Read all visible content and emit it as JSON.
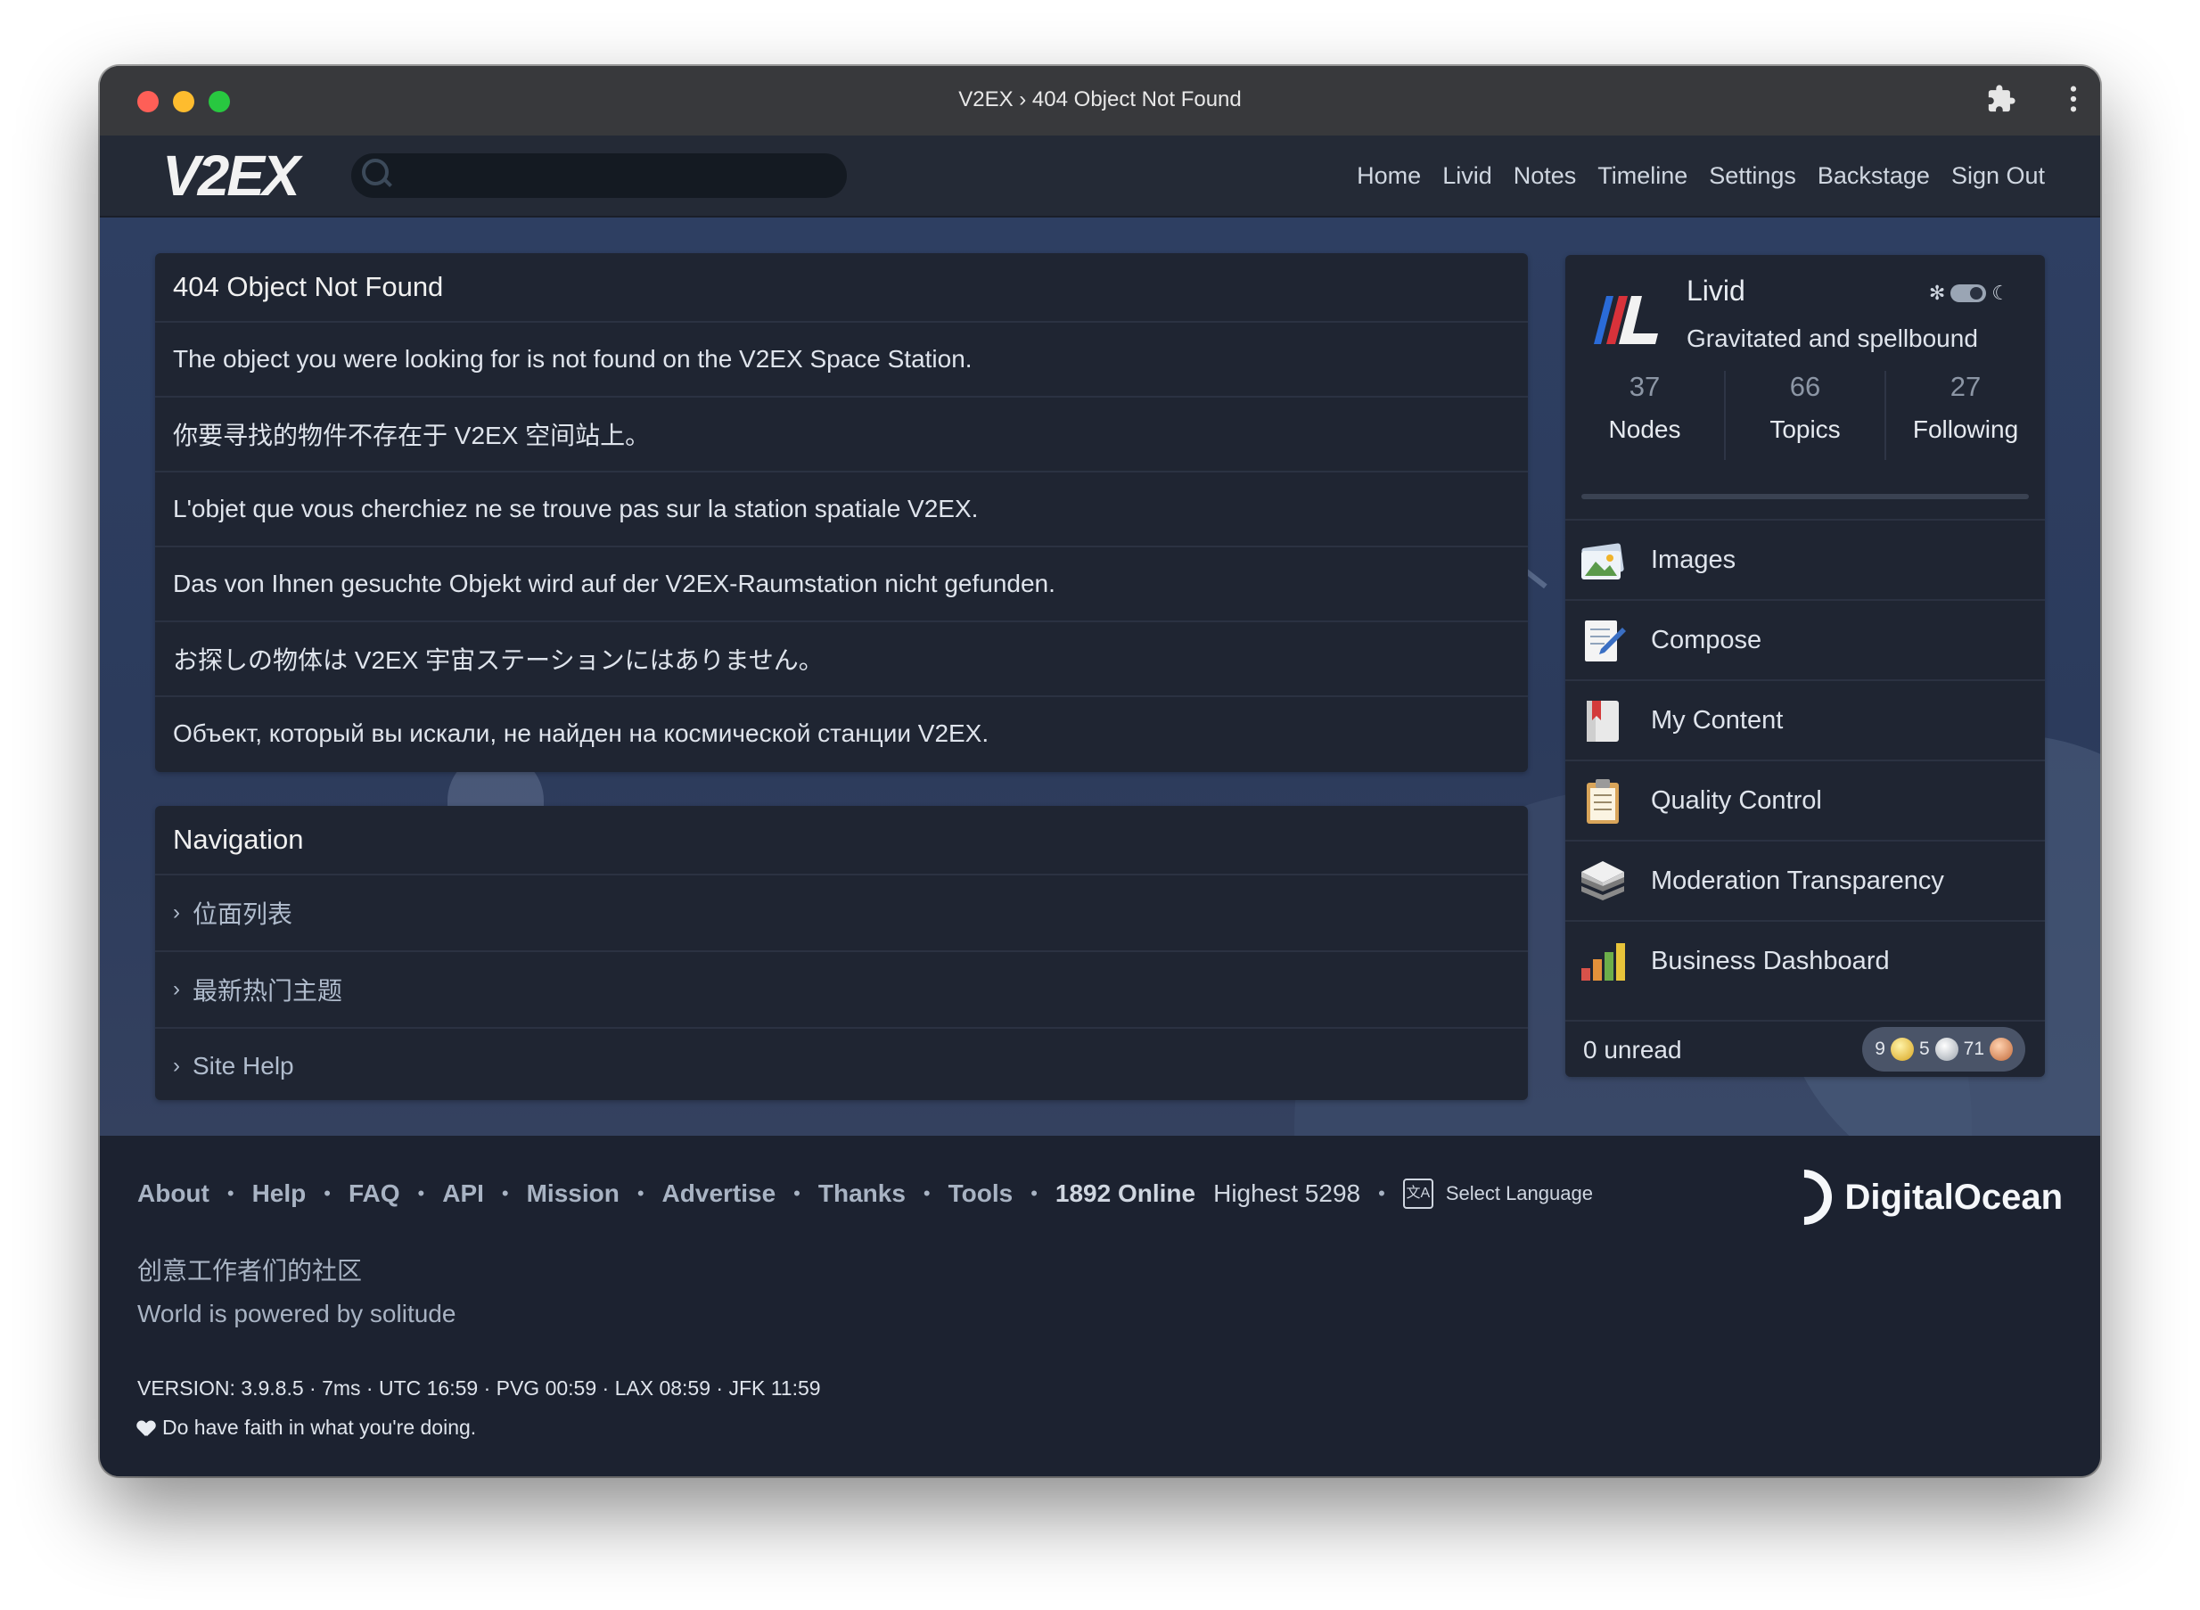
{
  "window": {
    "title": "V2EX › 404 Object Not Found"
  },
  "header": {
    "logo": "V2EX",
    "search": {
      "value": "",
      "placeholder": ""
    },
    "nav": [
      "Home",
      "Livid",
      "Notes",
      "Timeline",
      "Settings",
      "Backstage",
      "Sign Out"
    ]
  },
  "error_box": {
    "title": "404 Object Not Found",
    "messages": [
      "The object you were looking for is not found on the V2EX Space Station.",
      "你要寻找的物件不存在于 V2EX 空间站上。",
      "L'objet que vous cherchiez ne se trouve pas sur la station spatiale V2EX.",
      "Das von Ihnen gesuchte Objekt wird auf der V2EX-Raumstation nicht gefunden.",
      "お探しの物体は V2EX 宇宙ステーションにはありません。",
      "Объект, который вы искали, не найден на космической станции V2EX."
    ]
  },
  "navigation_box": {
    "title": "Navigation",
    "items": [
      "位面列表",
      "最新热门主题",
      "Site Help"
    ]
  },
  "sidebar": {
    "user": {
      "name": "Livid",
      "tagline": "Gravitated and spellbound"
    },
    "stats": [
      {
        "value": "37",
        "label": "Nodes"
      },
      {
        "value": "66",
        "label": "Topics"
      },
      {
        "value": "27",
        "label": "Following"
      }
    ],
    "menu": [
      {
        "label": "Images",
        "icon": "images-icon"
      },
      {
        "label": "Compose",
        "icon": "compose-icon"
      },
      {
        "label": "My Content",
        "icon": "bookmark-book-icon"
      },
      {
        "label": "Quality Control",
        "icon": "clipboard-icon"
      },
      {
        "label": "Moderation Transparency",
        "icon": "layers-icon"
      },
      {
        "label": "Business Dashboard",
        "icon": "bar-chart-icon"
      }
    ],
    "unread": "0 unread",
    "balance": {
      "gold": "9",
      "silver": "5",
      "bronze": "71"
    }
  },
  "footer": {
    "links": [
      "About",
      "Help",
      "FAQ",
      "API",
      "Mission",
      "Advertise",
      "Thanks",
      "Tools"
    ],
    "online": "1892 Online",
    "highest": "Highest 5298",
    "language": "Select Language",
    "sponsor": "DigitalOcean",
    "slogan_cn": "创意工作者们的社区",
    "slogan_en": "World is powered by solitude",
    "version": "VERSION: 3.9.8.5 · 7ms · UTC 16:59 · PVG 00:59 · LAX 08:59 · JFK 11:59",
    "faith": "Do have faith in what you're doing."
  },
  "colors": {
    "page_bg": "#2e3f62",
    "box_bg": "#1f2532",
    "footer_bg": "#1c2230",
    "gold": "#d8a520",
    "silver": "#9ba3ac",
    "bronze": "#c26a3a"
  }
}
